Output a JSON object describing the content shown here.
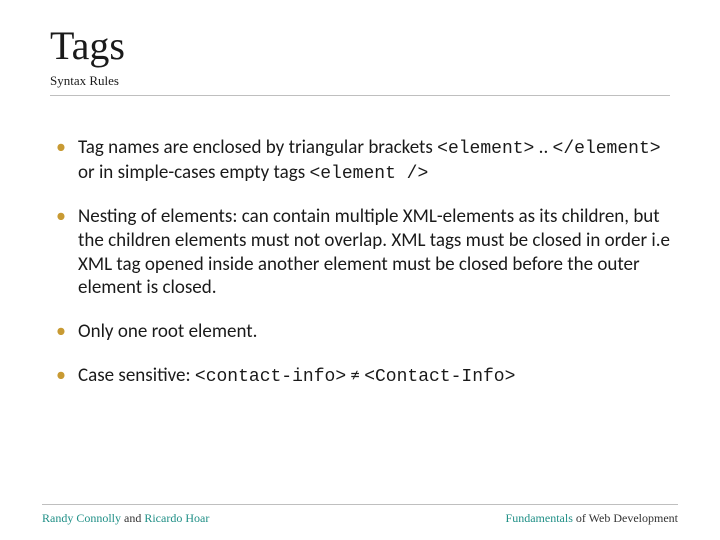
{
  "header": {
    "title": "Tags",
    "subtitle": "Syntax Rules"
  },
  "bullets": {
    "b1": {
      "t1": "Tag names are enclosed by triangular brackets ",
      "code1": "<element>",
      "t2": " .. ",
      "code2": "</element>",
      "t3": " or in simple-cases empty tags ",
      "code3": "<element />"
    },
    "b2": "Nesting of elements: can contain multiple XML-elements as its children, but the children elements must not overlap. XML tags must be closed in order i.e XML tag opened inside another element must be closed before the outer element is closed.",
    "b3": "Only one root element.",
    "b4": {
      "t1": "Case sensitive: ",
      "code1": "<contact-info>",
      "t2": " ≠ ",
      "code2": "<Contact-Info>"
    }
  },
  "footer": {
    "left": {
      "a1": "Randy Connolly",
      "t1": " and ",
      "a2": "Ricardo Hoar"
    },
    "right": {
      "t1": "Fundamentals",
      "t2": " of Web Development"
    }
  }
}
